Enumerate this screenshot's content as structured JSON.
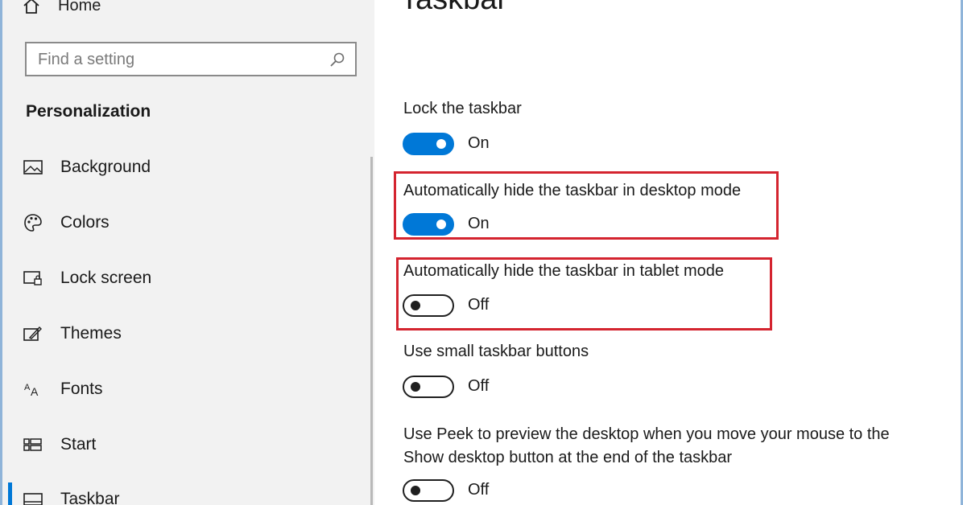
{
  "sidebar": {
    "home_label": "Home",
    "search_placeholder": "Find a setting",
    "section_title": "Personalization",
    "items": [
      {
        "label": "Background",
        "icon": "image-icon"
      },
      {
        "label": "Colors",
        "icon": "palette-icon"
      },
      {
        "label": "Lock screen",
        "icon": "lock-screen-icon"
      },
      {
        "label": "Themes",
        "icon": "themes-icon"
      },
      {
        "label": "Fonts",
        "icon": "fonts-icon"
      },
      {
        "label": "Start",
        "icon": "start-icon"
      },
      {
        "label": "Taskbar",
        "icon": "taskbar-icon"
      }
    ],
    "active_item": "Taskbar"
  },
  "main": {
    "title": "Taskbar",
    "settings": [
      {
        "label": "Lock the taskbar",
        "state": "On",
        "on": true
      },
      {
        "label": "Automatically hide the taskbar in desktop mode",
        "state": "On",
        "on": true,
        "highlighted": true
      },
      {
        "label": "Automatically hide the taskbar in tablet mode",
        "state": "Off",
        "on": false,
        "highlighted": true
      },
      {
        "label": "Use small taskbar buttons",
        "state": "Off",
        "on": false
      },
      {
        "label": "Use Peek to preview the desktop when you move your mouse to the Show desktop button at the end of the taskbar",
        "state": "Off",
        "on": false
      }
    ]
  },
  "colors": {
    "accent": "#0078d7",
    "highlight": "#d4242f",
    "sidebar_bg": "#f2f2f2"
  }
}
